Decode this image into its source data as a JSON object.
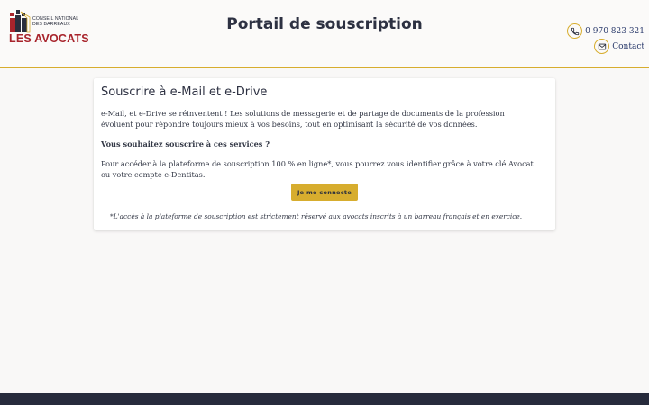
{
  "header": {
    "logo": {
      "line1": "CONSEIL NATIONAL",
      "line2": "DES BARREAUX",
      "line3": "LES AVOCATS"
    },
    "title": "Portail de souscription",
    "phone": "0 970 823 321",
    "contact": "Contact",
    "phone_icon": "phone-icon",
    "mail_icon": "mail-icon"
  },
  "card": {
    "title": "Souscrire à e-Mail et e-Drive",
    "paragraph1": "e-Mail, et e-Drive se réinventent ! Les solutions de messagerie et de partage de documents de la profession évoluent pour répondre toujours mieux à vos besoins, tout en optimisant la sécurité de vos données.",
    "question": "Vous souhaitez souscrire à ces services ?",
    "paragraph3": "Pour accéder à la plateforme de souscription 100 % en ligne*, vous pourrez vous identifier grâce à votre clé Avocat ou votre compte e-Dentitas.",
    "button": "Je me connecte",
    "footnote": "*L'accès à la plateforme de souscription est strictement réservé aux avocats inscrits à un barreau français et en exercice."
  },
  "colors": {
    "accent": "#d7ad2e",
    "brand_red": "#a8242c",
    "navy": "#2d3142",
    "footer": "#272b3c"
  }
}
